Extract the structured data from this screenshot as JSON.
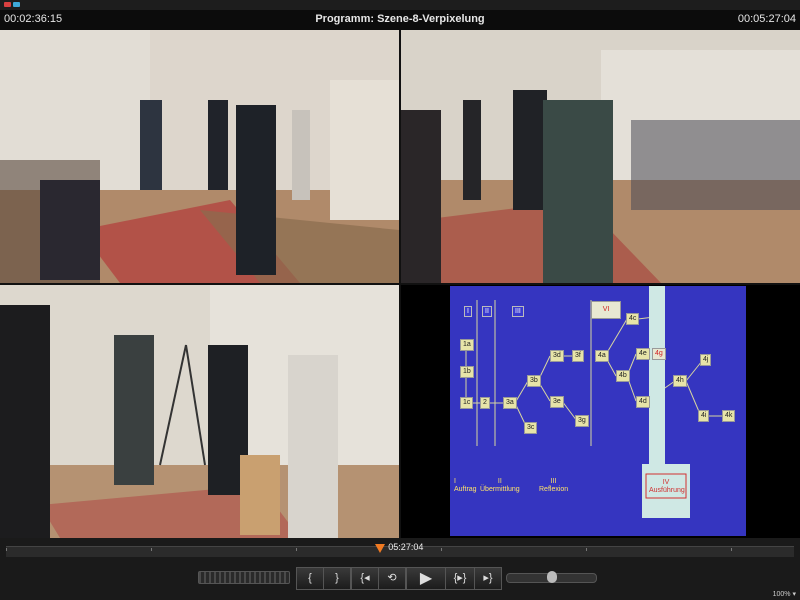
{
  "window": {
    "time_elapsed": "00:02:36:15",
    "title": "Programm: Szene-8-Verpixelung",
    "time_total": "00:05:27:04",
    "btn_colors": [
      "#d94040",
      "#3fa9d9"
    ]
  },
  "diagram": {
    "roman_labels": [
      "I",
      "II",
      "III"
    ],
    "box_top": "VI",
    "nodes": [
      {
        "id": "1a"
      },
      {
        "id": "1b"
      },
      {
        "id": "1c"
      },
      {
        "id": "2"
      },
      {
        "id": "3a"
      },
      {
        "id": "3b"
      },
      {
        "id": "3c"
      },
      {
        "id": "3d"
      },
      {
        "id": "3e"
      },
      {
        "id": "3f"
      },
      {
        "id": "3g"
      },
      {
        "id": "4a"
      },
      {
        "id": "4b"
      },
      {
        "id": "4c"
      },
      {
        "id": "4d"
      },
      {
        "id": "4e"
      },
      {
        "id": "4g"
      },
      {
        "id": "4h"
      },
      {
        "id": "4i"
      },
      {
        "id": "4j"
      },
      {
        "id": "4k"
      }
    ],
    "columns": [
      {
        "num": "I",
        "name": "Auftrag"
      },
      {
        "num": "II",
        "name": "Übermittlung"
      },
      {
        "num": "III",
        "name": "Reflexion"
      },
      {
        "num": "IV",
        "name": "Ausführung"
      }
    ]
  },
  "timeline": {
    "current_time": "05:27:04",
    "progress": 0.475
  },
  "controls": {
    "mark_in": "{",
    "mark_out": "}",
    "go_to_in": "{◂",
    "loop": "⟲",
    "play": "▶",
    "play_in_out": "{▸}",
    "go_to_out": "▸}",
    "volume_level": 0.5
  },
  "zoom": "100% ▾"
}
